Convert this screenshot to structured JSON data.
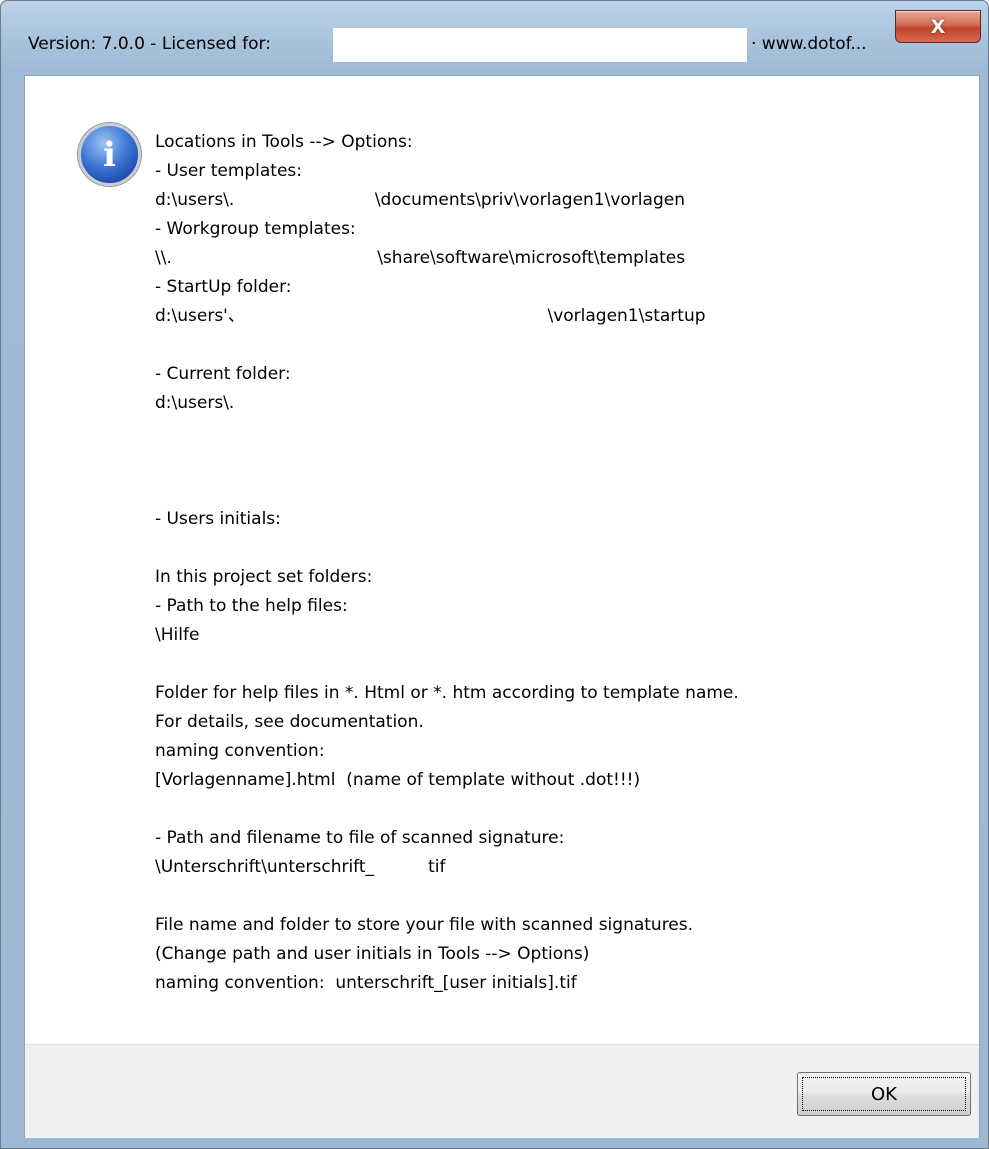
{
  "window": {
    "title_left": "Version: 7.0.0 - Licensed for: ",
    "title_right": "· www.dotof...",
    "close_glyph": "X"
  },
  "icon": {
    "name": "info-icon",
    "glyph": "i"
  },
  "message": {
    "lines": [
      "Locations in Tools --> Options:",
      "- User templates:",
      "d:\\users\\.                          \\documents\\priv\\vorlagen1\\vorlagen",
      "- Workgroup templates:",
      "\\\\.                                      \\share\\software\\microsoft\\templates",
      "- StartUp folder:",
      "d:\\users'、                                                        \\vorlagen1\\startup",
      "",
      "- Current folder:",
      "d:\\users\\.",
      "",
      "",
      "",
      "- Users initials:",
      "",
      "In this project set folders:",
      "- Path to the help files:",
      "\\Hilfe",
      "",
      "Folder for help files in *. Html or *. htm according to template name.",
      "For details, see documentation.",
      "naming convention:",
      "[Vorlagenname].html  (name of template without .dot!!!)",
      "",
      "- Path and filename to file of scanned signature:",
      "\\Unterschrift\\unterschrift_          tif",
      "",
      "File name and folder to store your file with scanned signatures.",
      "(Change path and user initials in Tools --> Options)",
      "naming convention:  unterschrift_[user initials].tif"
    ]
  },
  "buttons": {
    "ok_label": "OK"
  }
}
